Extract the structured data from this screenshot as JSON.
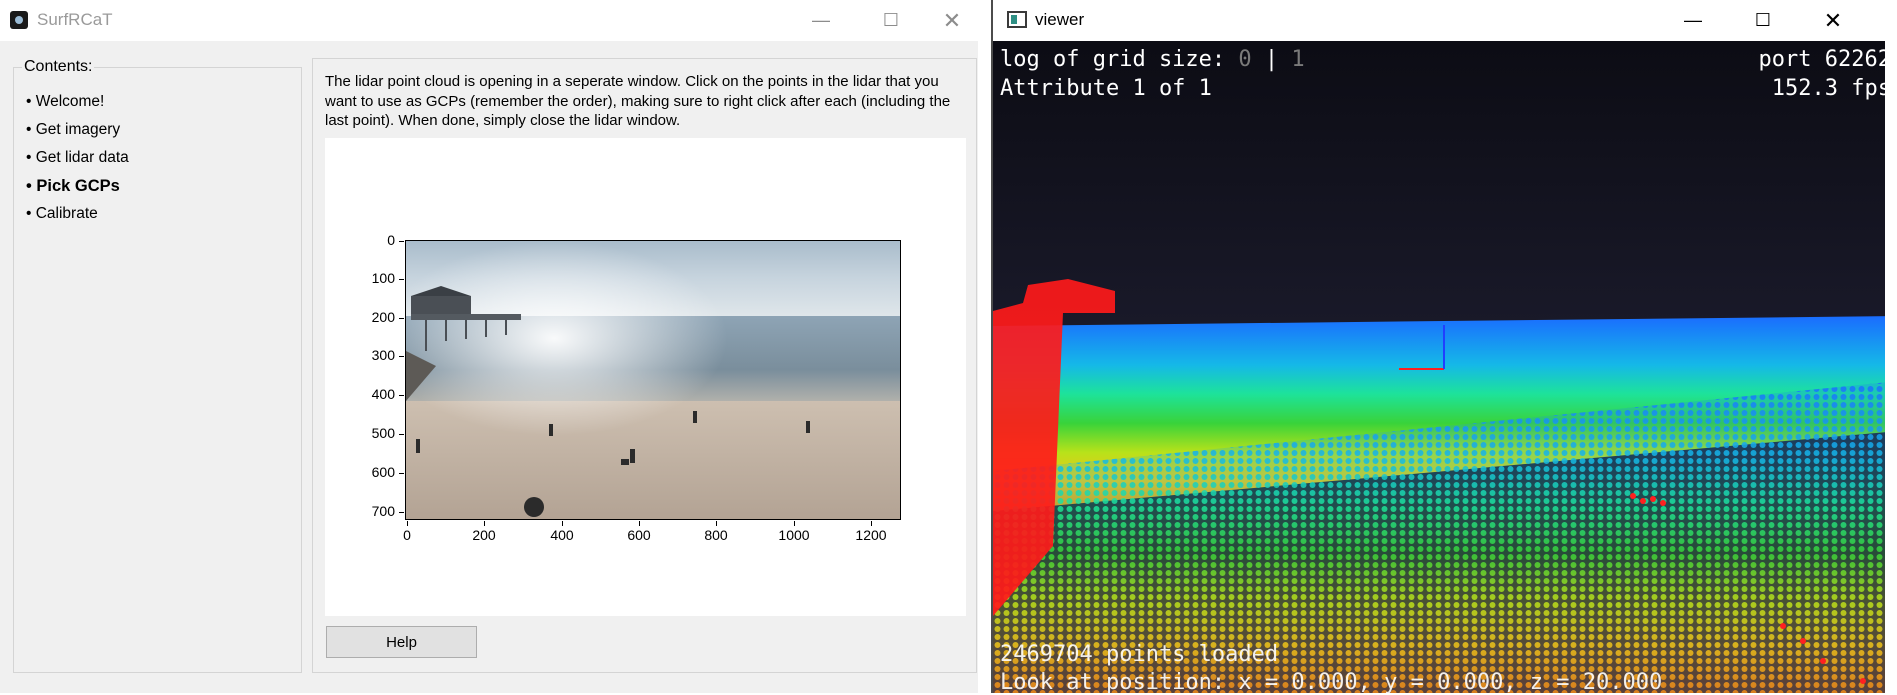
{
  "left_window": {
    "title": "SurfRCaT",
    "controls": {
      "minimize": "—",
      "maximize": "☐",
      "close": "✕"
    },
    "contents": {
      "label": "Contents:",
      "items": [
        {
          "label": "• Welcome!",
          "active": false
        },
        {
          "label": "• Get imagery",
          "active": false
        },
        {
          "label": "• Get lidar data",
          "active": false
        },
        {
          "label": "• Pick GCPs",
          "active": true
        },
        {
          "label": "• Calibrate",
          "active": false
        }
      ]
    },
    "instructions": "The lidar point cloud is opening in a seperate window. Click on the points in the lidar that you want to use as GCPs (remember the order), making sure to right click after each (including the last point). When done, simply close the lidar window.",
    "figure": {
      "y_ticks": [
        "0",
        "100",
        "200",
        "300",
        "400",
        "500",
        "600",
        "700"
      ],
      "x_ticks": [
        "0",
        "200",
        "400",
        "600",
        "800",
        "1000",
        "1200"
      ],
      "x_range": [
        0,
        1280
      ],
      "y_range": [
        0,
        720
      ]
    },
    "help_button": "Help"
  },
  "right_window": {
    "title": "viewer",
    "controls": {
      "minimize": "—",
      "maximize": "☐",
      "close": "✕"
    },
    "hud": {
      "grid_label": "log of grid size: ",
      "grid_a": "0",
      "grid_sep": " | ",
      "grid_b": "1",
      "attribute": "Attribute 1 of 1",
      "port": "port 62262",
      "fps": "152.3 fps",
      "points_loaded": "2469704 points loaded",
      "look_at": "Look at position: x = 0.000, y = 0.000, z = 20.000"
    }
  },
  "colors": {
    "window_bg": "#f0f0f0",
    "viewer_bg": "#12121c",
    "pier_points": "#ff0000",
    "water_points": "#1a8cff",
    "beach_points": "#d8e600"
  }
}
